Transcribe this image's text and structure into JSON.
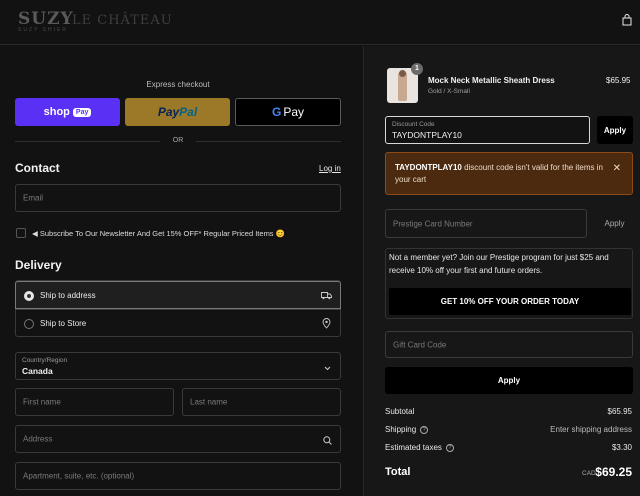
{
  "header": {
    "logo_suzy": "SUZY",
    "logo_sub": "SUZY SHIER",
    "logo_lc": "LE CHÂTEAU",
    "cart_icon": "shopping-bag-icon"
  },
  "express": {
    "title": "Express checkout",
    "shop_label": "shop",
    "shop_pill": "Pay",
    "paypal_a": "Pay",
    "paypal_b": "Pal",
    "gpay_g": "G",
    "gpay_label": "Pay",
    "or": "OR"
  },
  "contact": {
    "heading": "Contact",
    "login": "Log in",
    "email_placeholder": "Email",
    "newsletter": "◀ Subscribe To Our Newsletter And Get 15% OFF* Regular Priced Items 😊"
  },
  "delivery": {
    "heading": "Delivery",
    "ship_to_address": "Ship to address",
    "ship_to_store": "Ship to Store",
    "country_label": "Country/Region",
    "country_value": "Canada",
    "first_name": "First name",
    "last_name": "Last name",
    "address": "Address",
    "apartment": "Apartment, suite, etc. (optional)"
  },
  "order": {
    "quantity": "1",
    "product_name": "Mock Neck Metallic Sheath Dress",
    "variant": "Gold / X-Small",
    "price": "$65.95"
  },
  "discount": {
    "label": "Discount Code",
    "value": "TAYDONTPLAY10",
    "apply": "Apply",
    "error_code": "TAYDONTPLAY10",
    "error_msg": " discount code isn't valid for the items in your cart"
  },
  "prestige": {
    "placeholder": "Prestige Card Number",
    "apply": "Apply",
    "member_text": "Not a member yet? Join our Prestige program for just $25 and receive 10% off your first and future orders.",
    "cta": "GET 10% OFF YOUR ORDER TODAY"
  },
  "gift": {
    "placeholder": "Gift Card Code",
    "apply": "Apply"
  },
  "summary": {
    "subtotal_label": "Subtotal",
    "subtotal_value": "$65.95",
    "shipping_label": "Shipping",
    "shipping_value": "Enter shipping address",
    "taxes_label": "Estimated taxes",
    "taxes_value": "$3.30",
    "total_label": "Total",
    "currency": "CAD",
    "total_value": "$69.25"
  },
  "colors": {
    "shop_pay": "#5a31f4",
    "paypal": "#ffc439",
    "error_bg": "#4b2a10"
  }
}
